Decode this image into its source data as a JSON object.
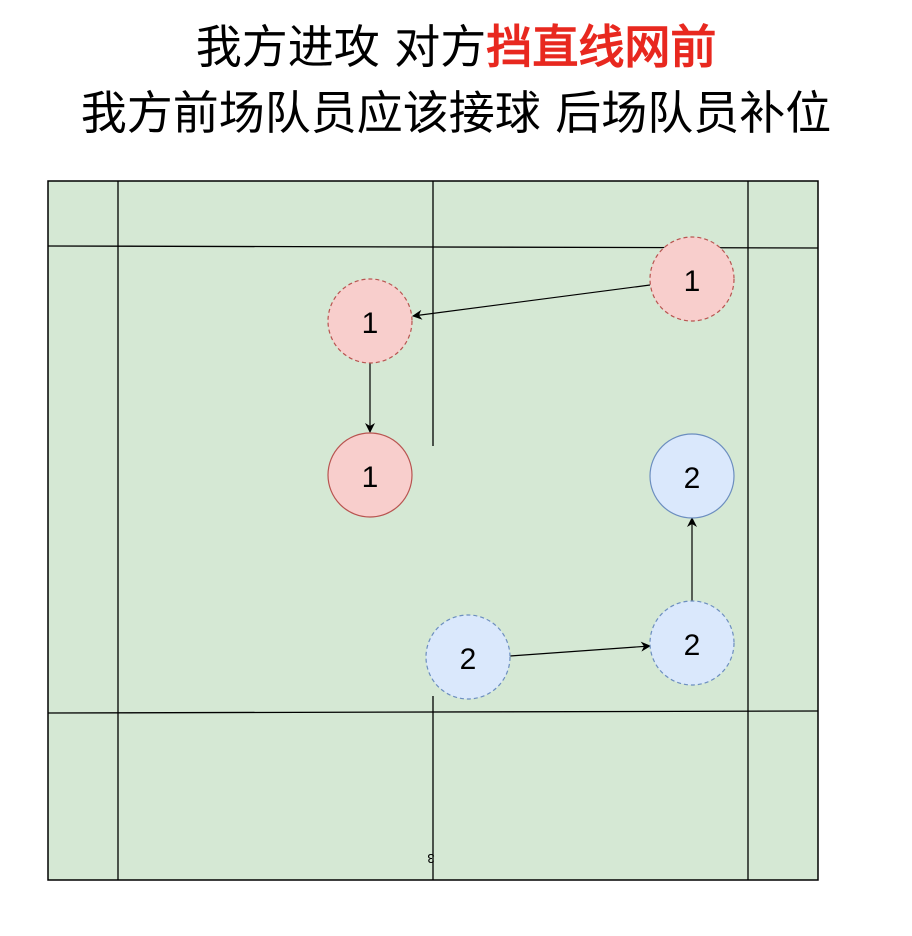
{
  "title": {
    "line1_plain": "我方进攻 对方",
    "line1_highlight": "挡直线网前",
    "line2": "我方前场队员应该接球 后场队员补位",
    "highlight_color": "#e8281f"
  },
  "court": {
    "fill": "#d5e8d4",
    "center_mark": "3"
  },
  "players": [
    {
      "id": "p1-start",
      "label": "1",
      "team": "red",
      "style": "dashed"
    },
    {
      "id": "p1-mid",
      "label": "1",
      "team": "red",
      "style": "dashed"
    },
    {
      "id": "p1-end",
      "label": "1",
      "team": "red",
      "style": "solid"
    },
    {
      "id": "p2-end",
      "label": "2",
      "team": "blue",
      "style": "solid"
    },
    {
      "id": "p2-mid",
      "label": "2",
      "team": "blue",
      "style": "dashed"
    },
    {
      "id": "p2-start",
      "label": "2",
      "team": "blue",
      "style": "dashed"
    }
  ],
  "team_colors": {
    "red": {
      "fill": "#f8cecc",
      "stroke": "#b85450"
    },
    "blue": {
      "fill": "#dae8fc",
      "stroke": "#6c8ebf"
    }
  },
  "arrows": [
    {
      "from": "p1-start",
      "to": "p1-mid"
    },
    {
      "from": "p1-mid",
      "to": "p1-end"
    },
    {
      "from": "p2-start",
      "to": "p2-mid"
    },
    {
      "from": "p2-mid",
      "to": "p2-end"
    }
  ]
}
